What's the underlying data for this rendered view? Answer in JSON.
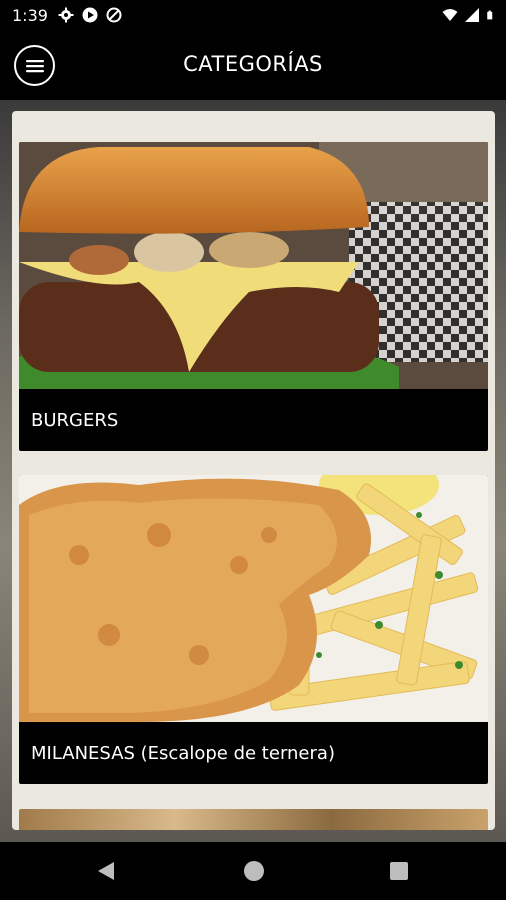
{
  "status_bar": {
    "time": "1:39",
    "left_icons": [
      "gear-icon",
      "play-icon",
      "no-disturb-icon"
    ],
    "right_icons": [
      "wifi-icon",
      "signal-icon",
      "battery-icon"
    ]
  },
  "app_bar": {
    "title": "CATEGORÍAS",
    "menu_icon": "hamburger-menu-icon"
  },
  "categories": [
    {
      "label": "BURGERS",
      "image": "burger-photo"
    },
    {
      "label": "MILANESAS (Escalope de ternera)",
      "image": "milanesa-photo"
    }
  ],
  "nav_bar": {
    "icons": [
      "back-icon",
      "home-icon",
      "recents-icon"
    ]
  }
}
